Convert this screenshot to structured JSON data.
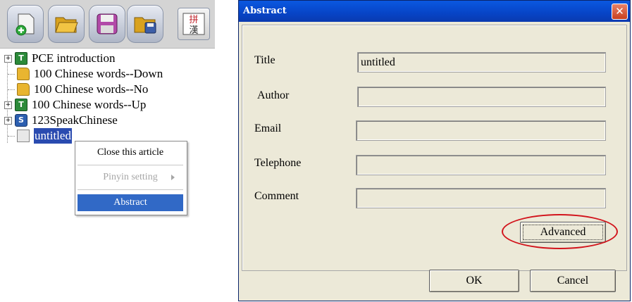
{
  "toolbar": {
    "buttons": [
      {
        "icon": "new-document-icon"
      },
      {
        "icon": "open-folder-icon"
      },
      {
        "icon": "save-icon"
      },
      {
        "icon": "save-as-icon"
      },
      {
        "icon": "pinyin-icon",
        "glyphs": "拼漢"
      }
    ]
  },
  "tree": {
    "items": [
      {
        "label": "PCE introduction",
        "icon": "text-icon",
        "expandable": true
      },
      {
        "label": "100 Chinese words--Down",
        "icon": "folder-icon",
        "expandable": false
      },
      {
        "label": "100 Chinese words--No",
        "icon": "folder-icon",
        "expandable": false
      },
      {
        "label": "100 Chinese words--Up",
        "icon": "text-icon",
        "expandable": true
      },
      {
        "label": "123SpeakChinese",
        "icon": "speak-icon",
        "expandable": true
      },
      {
        "label": "untitled",
        "icon": "document-icon",
        "expandable": false,
        "selected": true
      }
    ]
  },
  "context_menu": {
    "items": [
      {
        "label": "Close this article",
        "enabled": true
      },
      {
        "label": "Pinyin setting",
        "enabled": false,
        "submenu": true
      },
      {
        "label": "Abstract",
        "enabled": true,
        "highlighted": true
      }
    ]
  },
  "dialog": {
    "title": "Abstract",
    "fields": [
      {
        "label": "Title",
        "value": "untitled"
      },
      {
        "label": "Author",
        "value": ""
      },
      {
        "label": "Email",
        "value": ""
      },
      {
        "label": "Telephone",
        "value": ""
      },
      {
        "label": "Comment",
        "value": ""
      }
    ],
    "advanced_label": "Advanced",
    "ok_label": "OK",
    "cancel_label": "Cancel",
    "annotation_color": "#d2141c"
  }
}
